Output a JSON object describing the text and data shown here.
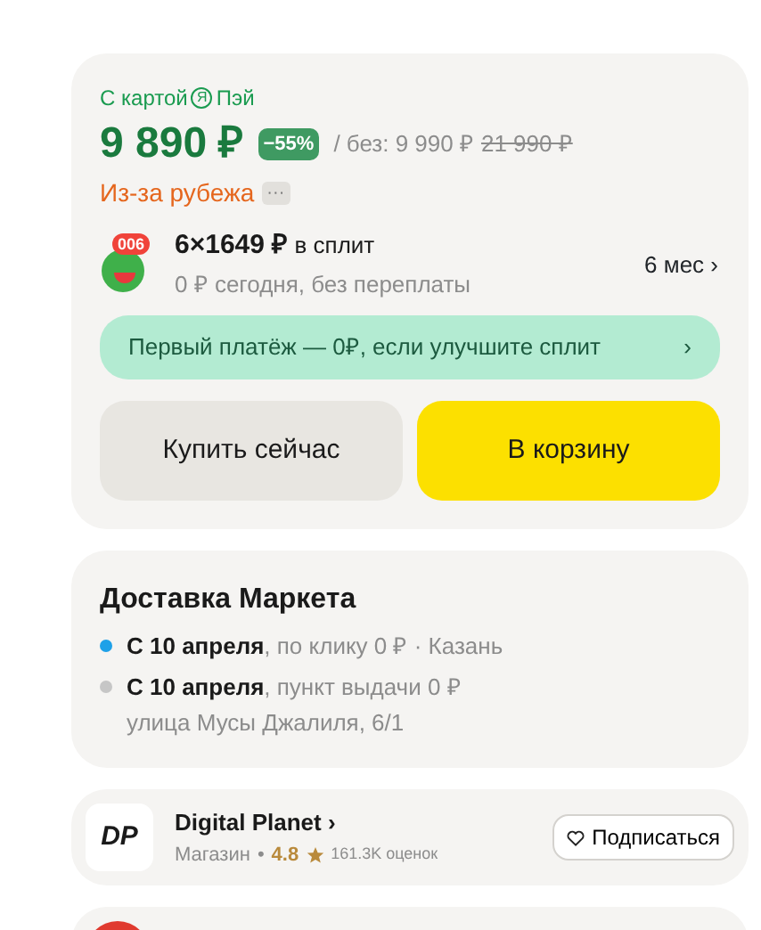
{
  "offer": {
    "pay_label": {
      "prefix": "С картой",
      "logo": "Я",
      "suffix": "Пэй"
    },
    "price": "9 890 ₽",
    "discount": "−55%",
    "price_without": "/ без: 9 990 ₽",
    "old_price": "21 990 ₽",
    "origin": "Из-за рубежа",
    "origin_more": "···",
    "split": {
      "badge": "006",
      "title": "6×1649 ₽",
      "title_suffix": "в сплит",
      "subtitle": "0 ₽ сегодня, без переплаты",
      "term": "6 мес",
      "term_arrow": "›"
    },
    "promo": {
      "text": "Первый платёж — 0₽, если улучшите сплит",
      "arrow": "›"
    },
    "buttons": [
      {
        "label": "Купить сейчас",
        "kind": "secondary"
      },
      {
        "label": "В корзину",
        "kind": "primary"
      }
    ]
  },
  "delivery": {
    "title": "Доставка Маркета",
    "options": [
      {
        "date": "С 10 апреля",
        "details": ", по клику 0 ₽ · Казань",
        "color": "#1ea1e8"
      },
      {
        "date": "С 10 апреля",
        "details": ", пункт выдачи 0 ₽",
        "address": "улица Мусы Джалиля, 6/1",
        "color": "#c6c6c6"
      }
    ]
  },
  "shop": {
    "logo": "DP",
    "name": "Digital Planet",
    "name_arrow": "›",
    "type": "Магазин",
    "separator": "•",
    "rating": "4.8",
    "reviews": "161.3K оценок",
    "subscribe": "Подписаться"
  }
}
